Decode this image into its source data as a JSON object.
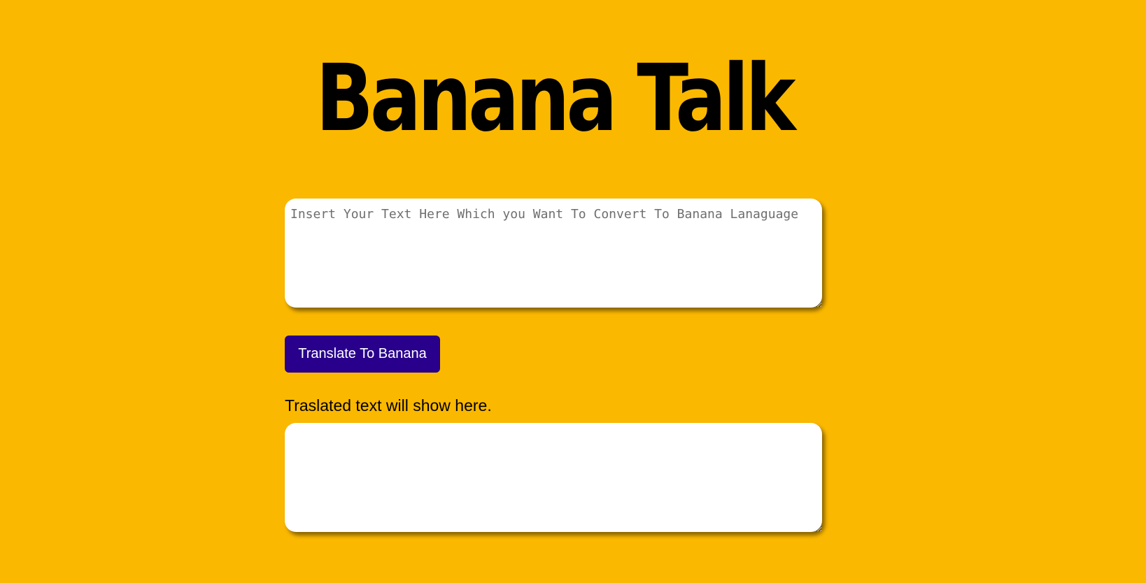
{
  "app": {
    "title": "Banana Talk"
  },
  "input": {
    "placeholder": "Insert Your Text Here Which you Want To Convert To Banana Lanaguage",
    "value": ""
  },
  "translate_button": {
    "label": "Translate To Banana"
  },
  "output": {
    "label": "Traslated text will show here.",
    "value": ""
  },
  "colors": {
    "background": "#fbb800",
    "button": "#28008c",
    "title": "#000000"
  }
}
